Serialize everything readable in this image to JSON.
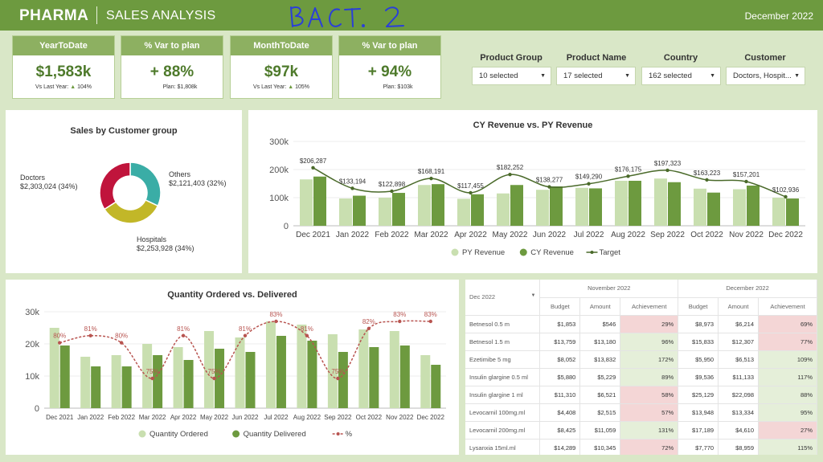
{
  "header": {
    "brand": "PHARMA",
    "subtitle": "SALES ANALYSIS",
    "scribble": "BACT. 2",
    "date": "December 2022"
  },
  "kpis": [
    {
      "title": "YearToDate",
      "value": "$1,583k",
      "sub_label": "Vs Last Year:",
      "sub_value": "104%",
      "arrow": true
    },
    {
      "title": "% Var to plan",
      "value": "+ 88%",
      "sub_label": "Plan:",
      "sub_value": "$1,808k",
      "arrow": false
    },
    {
      "title": "MonthToDate",
      "value": "$97k",
      "sub_label": "Vs Last Year:",
      "sub_value": "105%",
      "arrow": true
    },
    {
      "title": "% Var to plan",
      "value": "+ 94%",
      "sub_label": "Plan:",
      "sub_value": "$103k",
      "arrow": false
    }
  ],
  "filters": [
    {
      "label": "Product Group",
      "value": "10 selected"
    },
    {
      "label": "Product Name",
      "value": "17 selected"
    },
    {
      "label": "Country",
      "value": "162 selected"
    },
    {
      "label": "Customer",
      "value": "Doctors, Hospit..."
    }
  ],
  "donut": {
    "title": "Sales by Customer group",
    "colors": {
      "Others": "#3aada6",
      "Hospitals": "#c2b728",
      "Doctors": "#c0143c"
    },
    "slices": [
      {
        "name": "Others",
        "value": "$2,121,403 (32%)",
        "share": 0.32
      },
      {
        "name": "Hospitals",
        "value": "$2,253,928 (34%)",
        "share": 0.34
      },
      {
        "name": "Doctors",
        "value": "$2,303,024 (34%)",
        "share": 0.34
      }
    ]
  },
  "chart_data": [
    {
      "type": "bar",
      "title": "CY Revenue vs. PY Revenue",
      "categories": [
        "Dec 2021",
        "Jan 2022",
        "Feb 2022",
        "Mar 2022",
        "Apr 2022",
        "May 2022",
        "Jun 2022",
        "Jul 2022",
        "Aug 2022",
        "Sep 2022",
        "Oct 2022",
        "Nov 2022",
        "Dec 2022"
      ],
      "yticks": [
        "0",
        "100k",
        "200k",
        "300k"
      ],
      "ylim": [
        0,
        300000
      ],
      "series": [
        {
          "name": "PY Revenue",
          "color": "#c9dfb0",
          "values": [
            165000,
            97000,
            100000,
            145000,
            96000,
            115000,
            128000,
            135000,
            160000,
            168000,
            132000,
            130000,
            100000
          ]
        },
        {
          "name": "CY Revenue",
          "color": "#6d9a3f",
          "values": [
            175000,
            107000,
            117000,
            148000,
            112000,
            145000,
            140000,
            133000,
            160000,
            155000,
            118000,
            143000,
            97000
          ]
        },
        {
          "name": "Target",
          "color": "#4a6a2a",
          "values": [
            206287,
            133194,
            122898,
            168191,
            117455,
            182252,
            138277,
            149290,
            176175,
            197323,
            163223,
            157201,
            102936
          ],
          "labels": [
            "$206,287",
            "$133,194",
            "$122,898",
            "$168,191",
            "$117,455",
            "$182,252",
            "$138,277",
            "$149,290",
            "$176,175",
            "$197,323",
            "$163,223",
            "$157,201",
            "$102,936"
          ]
        }
      ],
      "legend": "bottom"
    },
    {
      "type": "bar",
      "title": "Quantity Ordered vs. Delivered",
      "categories": [
        "Dec 2021",
        "Jan 2022",
        "Feb 2022",
        "Mar 2022",
        "Apr 2022",
        "May 2022",
        "Jun 2022",
        "Jul 2022",
        "Aug 2022",
        "Sep 2022",
        "Oct 2022",
        "Nov 2022",
        "Dec 2022"
      ],
      "yticks": [
        "0",
        "10k",
        "20k",
        "30k"
      ],
      "ylim": [
        0,
        30000
      ],
      "series": [
        {
          "name": "Quantity Ordered",
          "color": "#c9dfb0",
          "values": [
            25000,
            16000,
            16500,
            20000,
            19000,
            24000,
            22000,
            27000,
            26000,
            23000,
            24500,
            24000,
            16500
          ]
        },
        {
          "name": "Quantity Delivered",
          "color": "#6d9a3f",
          "values": [
            19500,
            13000,
            13000,
            16500,
            15000,
            18500,
            17500,
            22500,
            21000,
            17500,
            19000,
            19500,
            13500
          ]
        },
        {
          "name": "%",
          "color": "#b85450",
          "values": [
            0.8,
            0.81,
            0.8,
            0.75,
            0.81,
            0.75,
            0.81,
            0.83,
            0.81,
            0.75,
            0.82,
            0.83,
            0.83
          ],
          "labels": [
            "80%",
            "81%",
            "80%",
            "75%",
            "81%",
            "75%",
            "81%",
            "83%",
            "81%",
            "75%",
            "82%",
            "83%",
            "83%"
          ]
        }
      ],
      "legend": "bottom"
    }
  ],
  "table": {
    "period_select": "Dec 2022",
    "months": [
      "November 2022",
      "December 2022"
    ],
    "columns": [
      "Budget",
      "Amount",
      "Achievement"
    ],
    "rows": [
      {
        "product": "Betnesol 0.5 m",
        "nov": [
          "$1,853",
          "$546",
          "29%"
        ],
        "nov_bad": true,
        "dec": [
          "$8,973",
          "$6,214",
          "69%"
        ],
        "dec_bad": true
      },
      {
        "product": "Betnesol 1.5 m",
        "nov": [
          "$13,759",
          "$13,180",
          "96%"
        ],
        "nov_bad": false,
        "dec": [
          "$15,833",
          "$12,307",
          "77%"
        ],
        "dec_bad": true
      },
      {
        "product": "Ezetimibe 5 mg",
        "nov": [
          "$8,052",
          "$13,832",
          "172%"
        ],
        "nov_bad": false,
        "dec": [
          "$5,950",
          "$6,513",
          "109%"
        ],
        "dec_bad": false
      },
      {
        "product": "Insulin glargine 0.5 ml",
        "nov": [
          "$5,880",
          "$5,229",
          "89%"
        ],
        "nov_bad": false,
        "dec": [
          "$9,536",
          "$11,133",
          "117%"
        ],
        "dec_bad": false
      },
      {
        "product": "Insulin glargine 1 ml",
        "nov": [
          "$11,310",
          "$6,521",
          "58%"
        ],
        "nov_bad": true,
        "dec": [
          "$25,129",
          "$22,098",
          "88%"
        ],
        "dec_bad": false
      },
      {
        "product": "Levocarnil 100mg.ml",
        "nov": [
          "$4,408",
          "$2,515",
          "57%"
        ],
        "nov_bad": true,
        "dec": [
          "$13,948",
          "$13,334",
          "95%"
        ],
        "dec_bad": false
      },
      {
        "product": "Levocarnil 200mg.ml",
        "nov": [
          "$8,425",
          "$11,059",
          "131%"
        ],
        "nov_bad": false,
        "dec": [
          "$17,189",
          "$4,610",
          "27%"
        ],
        "dec_bad": true
      },
      {
        "product": "Lysanxia 15ml.ml",
        "nov": [
          "$14,289",
          "$10,345",
          "72%"
        ],
        "nov_bad": true,
        "dec": [
          "$7,770",
          "$8,959",
          "115%"
        ],
        "dec_bad": false
      }
    ]
  }
}
